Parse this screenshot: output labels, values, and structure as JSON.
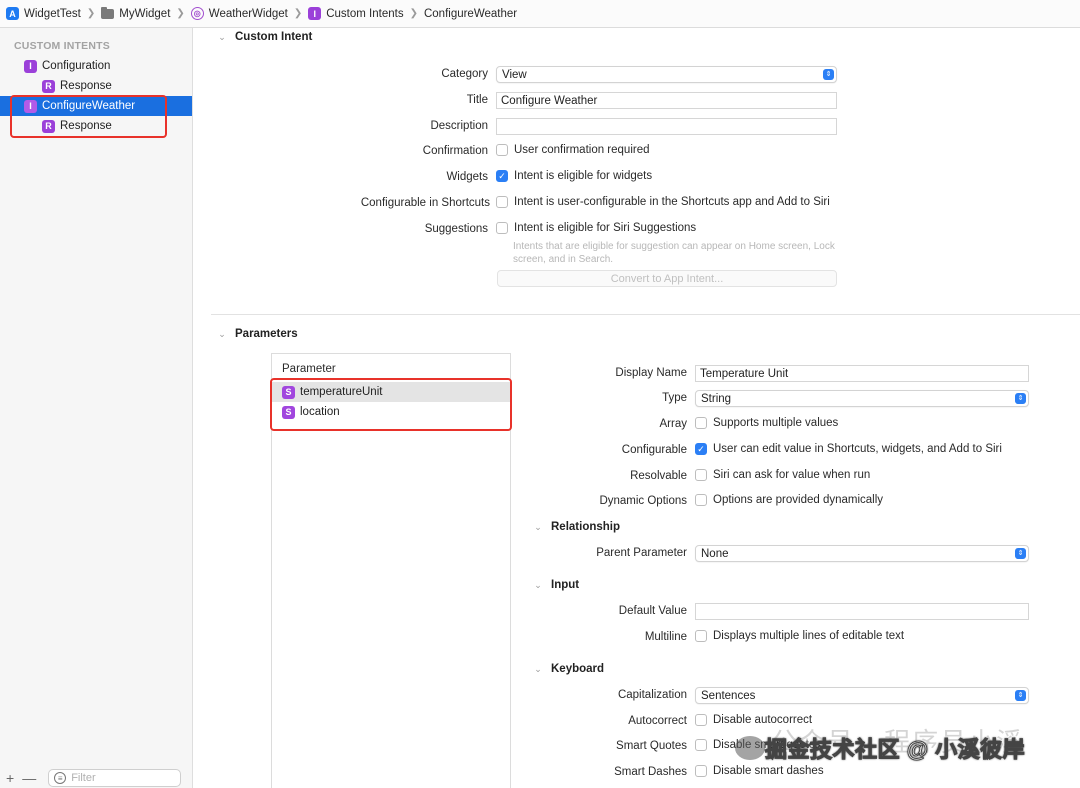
{
  "breadcrumb": [
    {
      "label": "WidgetTest",
      "icon": "xcode-project-icon"
    },
    {
      "label": "MyWidget",
      "icon": "folder-icon"
    },
    {
      "label": "WeatherWidget",
      "icon": "intent-definition-icon"
    },
    {
      "label": "Custom Intents",
      "icon": "intent-badge-icon"
    },
    {
      "label": "ConfigureWeather"
    }
  ],
  "badges": {
    "intent": "I",
    "response": "R",
    "string": "S"
  },
  "sidebar": {
    "heading": "CUSTOM INTENTS",
    "items": [
      {
        "label": "Configuration"
      },
      {
        "label": "Response"
      },
      {
        "label": "ConfigureWeather"
      },
      {
        "label": "Response"
      }
    ],
    "add": "+",
    "remove": "—",
    "filter_placeholder": "Filter"
  },
  "custom_intent": {
    "section_title": "Custom Intent",
    "category_label": "Category",
    "category_value": "View",
    "title_label": "Title",
    "title_value": "Configure Weather",
    "description_label": "Description",
    "description_value": "",
    "confirmation_label": "Confirmation",
    "confirmation_text": "User confirmation required",
    "confirmation_checked": false,
    "widgets_label": "Widgets",
    "widgets_text": "Intent is eligible for widgets",
    "widgets_checked": true,
    "shortcuts_label": "Configurable in Shortcuts",
    "shortcuts_text": "Intent is user-configurable in the Shortcuts app and Add to Siri",
    "shortcuts_checked": false,
    "suggestions_label": "Suggestions",
    "suggestions_text": "Intent is eligible for Siri Suggestions",
    "suggestions_checked": false,
    "suggestions_note": "Intents that are eligible for suggestion can appear on Home screen, Lock screen, and in Search.",
    "convert_button": "Convert to App Intent..."
  },
  "parameters": {
    "section_title": "Parameters",
    "list_header": "Parameter",
    "list": [
      {
        "name": "temperatureUnit",
        "selected": true
      },
      {
        "name": "location",
        "selected": false
      }
    ],
    "display_name_label": "Display Name",
    "display_name_value": "Temperature Unit",
    "type_label": "Type",
    "type_value": "String",
    "array_label": "Array",
    "array_text": "Supports multiple values",
    "configurable_label": "Configurable",
    "configurable_text": "User can edit value in Shortcuts, widgets, and Add to Siri",
    "resolvable_label": "Resolvable",
    "resolvable_text": "Siri can ask for value when run",
    "dynamic_label": "Dynamic Options",
    "dynamic_text": "Options are provided dynamically",
    "relationship_title": "Relationship",
    "parent_label": "Parent Parameter",
    "parent_value": "None",
    "input_title": "Input",
    "default_label": "Default Value",
    "default_value": "",
    "multiline_label": "Multiline",
    "multiline_text": "Displays multiple lines of editable text",
    "keyboard_title": "Keyboard",
    "capitalization_label": "Capitalization",
    "capitalization_value": "Sentences",
    "autocorrect_label": "Autocorrect",
    "autocorrect_text": "Disable autocorrect",
    "smartquotes_label": "Smart Quotes",
    "smartquotes_text": "Disable smart quotes",
    "smartdashes_label": "Smart Dashes",
    "smartdashes_text": "Disable smart dashes"
  },
  "watermark": {
    "back_text": "公众号 · 程序员小溪",
    "front_text": "掘金技术社区 @ 小溪彼岸"
  },
  "colors": {
    "accent": "#2b7ff5",
    "selection": "#1a6fe0",
    "annotation": "#e8322a",
    "badge": "#9b40d9"
  }
}
